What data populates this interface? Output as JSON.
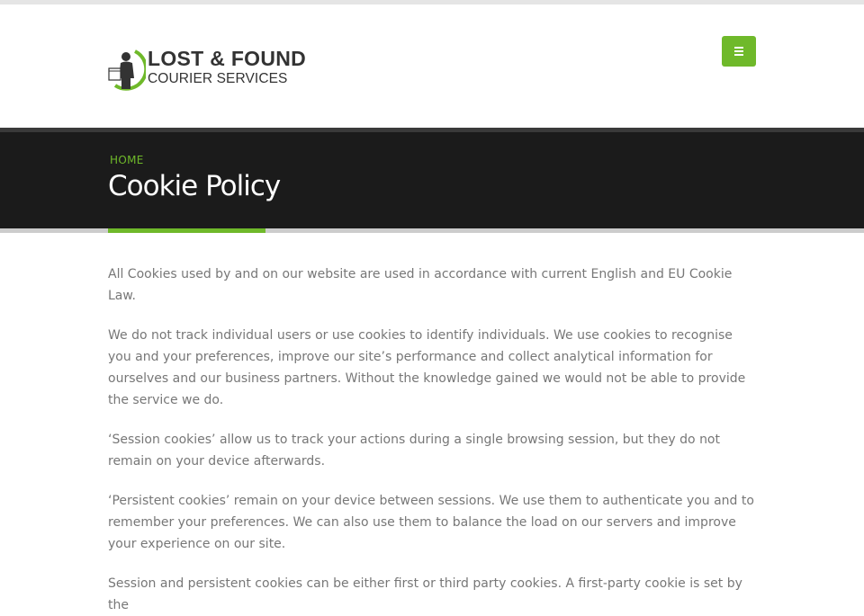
{
  "brand": {
    "line1": "LOST & FOUND",
    "line2": "COURIER SERVICES",
    "accent_color": "#6fb92a",
    "logo_icon": "courier-person-with-box-logo"
  },
  "header": {
    "menu_icon": "hamburger-menu-icon"
  },
  "page": {
    "breadcrumb": "HOME",
    "title": "Cookie Policy"
  },
  "content": {
    "paragraphs": [
      "All Cookies used by and on our website are used in accordance with current English and EU Cookie Law.",
      "We do not track individual users or use cookies to identify individuals. We use cookies to recognise you and your preferences, improve our site’s performance and collect analytical information for ourselves and our business partners. Without the knowledge gained we would not be able to provide the service we do.",
      "‘Session cookies’ allow us to track your actions during a single browsing session, but they do not remain on your device afterwards.",
      "‘Persistent cookies’ remain on your device between sessions. We use them to authenticate you and to remember your preferences. We can also use them to balance the load on our servers and improve your experience on our site.",
      "Session and persistent cookies can be either first or third party cookies. A first-party cookie is set by the"
    ]
  }
}
